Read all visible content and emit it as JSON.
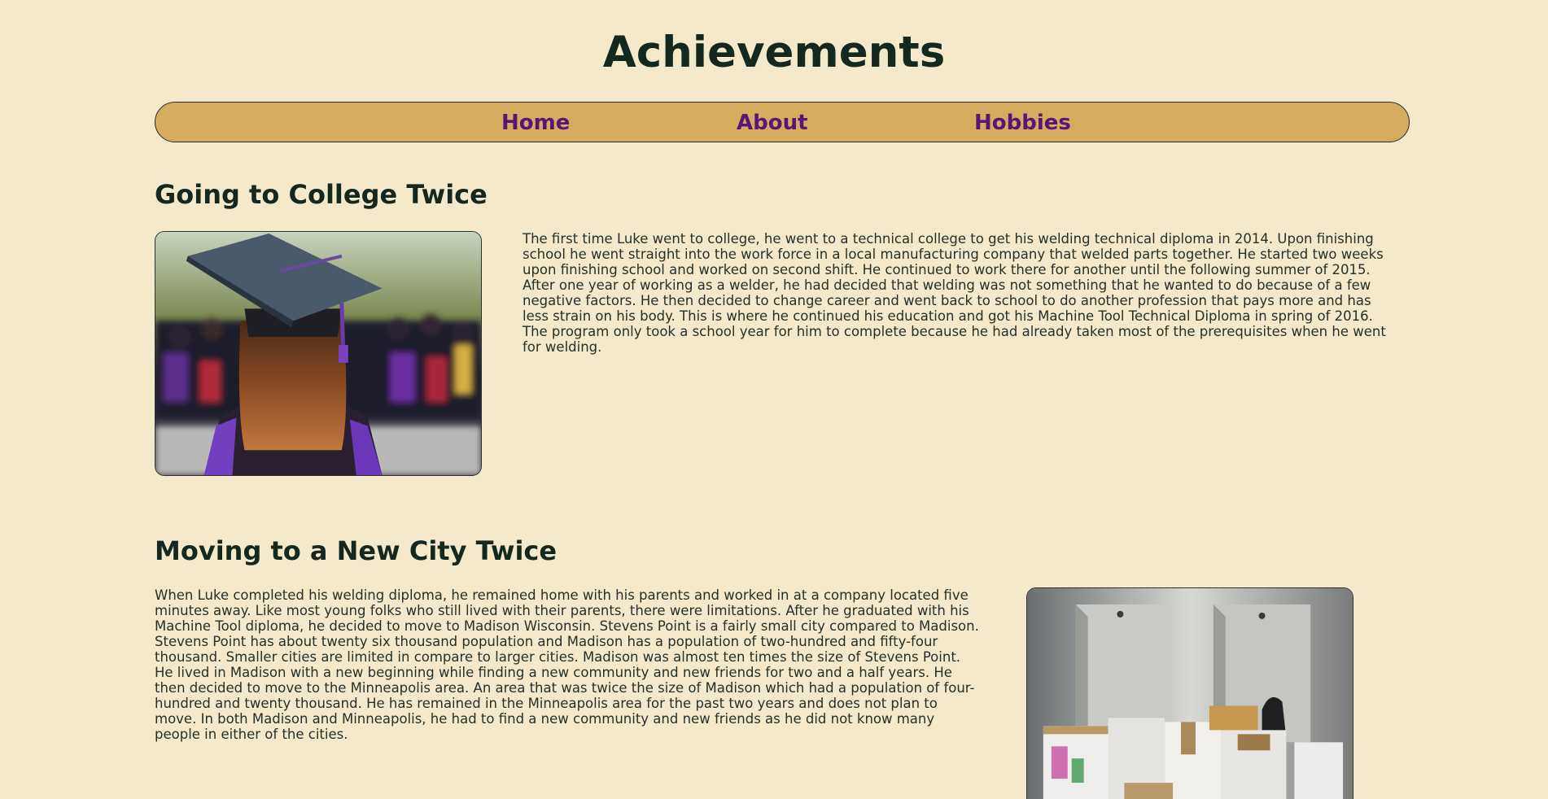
{
  "page": {
    "title": "Achievements"
  },
  "nav": {
    "items": [
      {
        "label": "Home"
      },
      {
        "label": "About"
      },
      {
        "label": "Hobbies"
      }
    ]
  },
  "sections": [
    {
      "heading": "Going to College Twice",
      "image": "graduate-photo",
      "text": "The first time Luke went to college, he went to a technical college to get his welding technical diploma in 2014. Upon finishing school he went straight into the work force in a local manufacturing company that welded parts together. He started two weeks upon finishing school and worked on second shift. He continued to work there for another until the following summer of 2015. After one year of working as a welder, he had decided that welding was not something that he wanted to do because of a few negative factors. He then decided to change career and went back to school to do another profession that pays more and has less strain on his body. This is where he continued his education and got his Machine Tool Technical Diploma in spring of 2016. The program only took a school year for him to complete because he had already taken most of the prerequisites when he went for welding."
    },
    {
      "heading": "Moving to a New City Twice",
      "image": "moving-boxes-photo",
      "text": "When Luke completed his welding diploma, he remained home with his parents and worked in at a company located five minutes away. Like most young folks who still lived with their parents, there were limitations. After he graduated with his Machine Tool diploma, he decided to move to Madison Wisconsin. Stevens Point is a fairly small city compared to Madison. Stevens Point has about twenty six thousand population and Madison has a population of two-hundred and fifty-four thousand. Smaller cities are limited in compare to larger cities. Madison was almost ten times the size of Stevens Point. He lived in Madison with a new beginning while finding a new community and new friends for two and a half years. He then decided to move to the Minneapolis area. An area that was twice the size of Madison which had a population of four-hundred and twenty thousand. He has remained in the Minneapolis area for the past two years and does not plan to move. In both Madison and Minneapolis, he had to find a new community and new friends as he did not know many people in either of the cities."
    }
  ],
  "colors": {
    "background": "#f5e9cc",
    "nav_background": "#d6ab5f",
    "nav_link": "#5b1375",
    "heading": "#15281f"
  }
}
